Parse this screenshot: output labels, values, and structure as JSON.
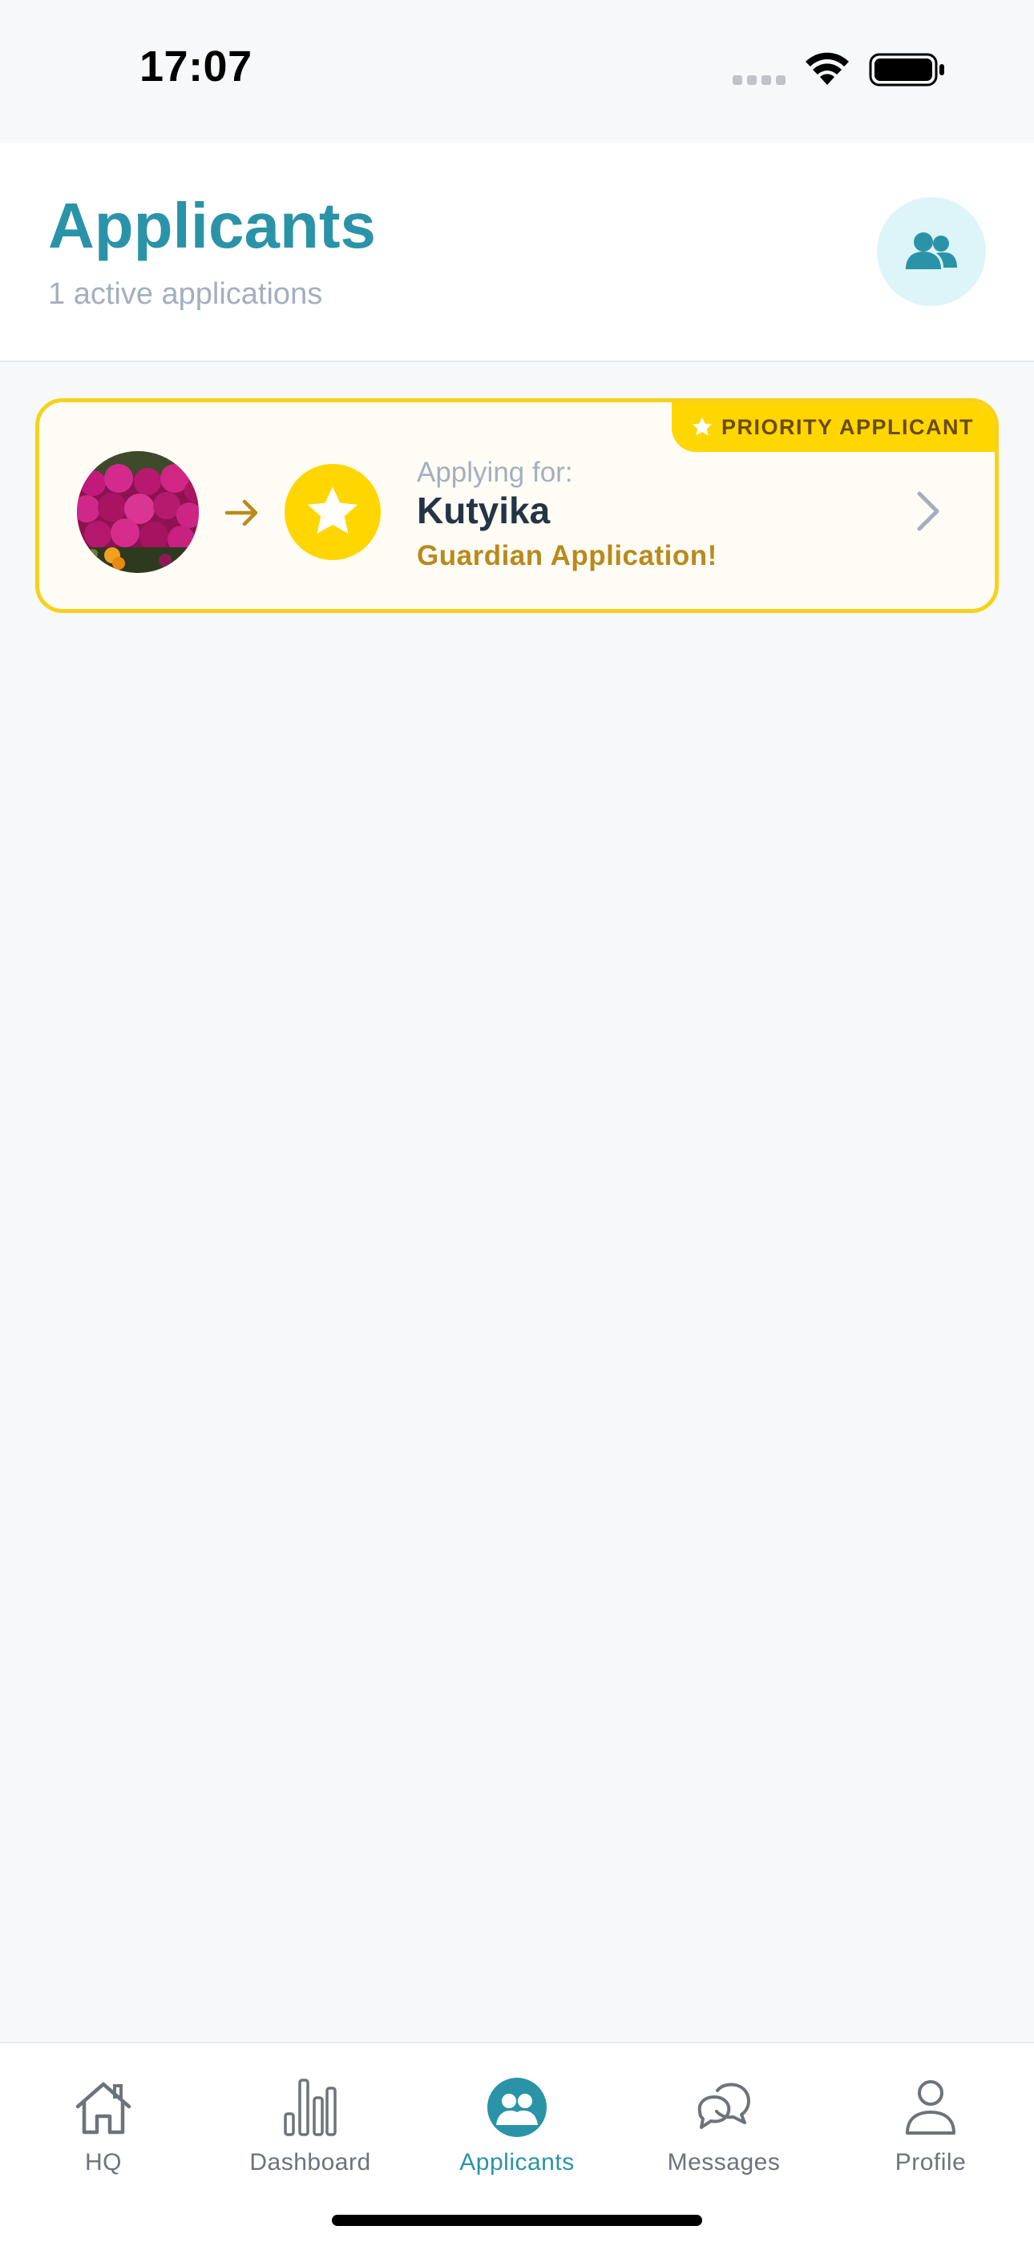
{
  "status_bar": {
    "time": "17:07"
  },
  "header": {
    "title": "Applicants",
    "subtitle": "1 active applications",
    "action_icon": "users-icon"
  },
  "applicants": [
    {
      "priority_label": "PRIORITY APPLICANT",
      "applying_label": "Applying for:",
      "pet_name": "Kutyika",
      "application_type": "Guardian Application!"
    }
  ],
  "tabs": [
    {
      "label": "HQ",
      "icon": "home-icon",
      "active": false
    },
    {
      "label": "Dashboard",
      "icon": "bar-chart-icon",
      "active": false
    },
    {
      "label": "Applicants",
      "icon": "users-icon",
      "active": true
    },
    {
      "label": "Messages",
      "icon": "chat-bubbles-icon",
      "active": false
    },
    {
      "label": "Profile",
      "icon": "person-icon",
      "active": false
    }
  ],
  "colors": {
    "accent": "#2A93A8",
    "priority": "#FFD600",
    "priority_border": "#F8D21A",
    "application_type": "#B98A1C"
  }
}
